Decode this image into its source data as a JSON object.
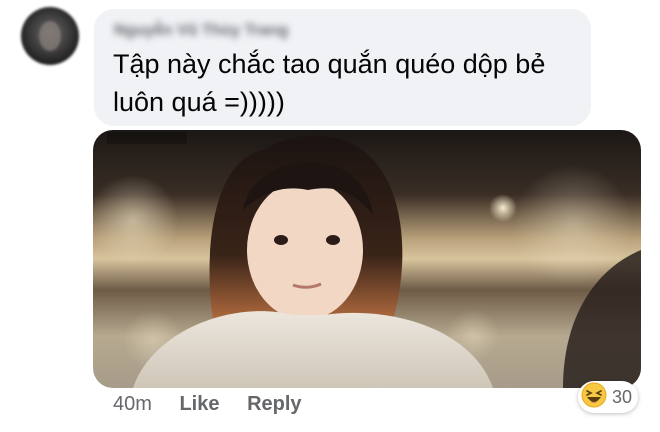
{
  "comment": {
    "author_name": "Nguyễn Vũ Thùy Trang",
    "text_line1": "Tập này chắc tao quắn quéo dộp bẻ",
    "text_line2": "luôn quá =)))))"
  },
  "attachment": {
    "icon": "gif-photo"
  },
  "footer": {
    "timestamp": "40m",
    "like_label": "Like",
    "reply_label": "Reply",
    "reaction_icon": "haha-emoji-icon",
    "reaction_count": "30"
  }
}
